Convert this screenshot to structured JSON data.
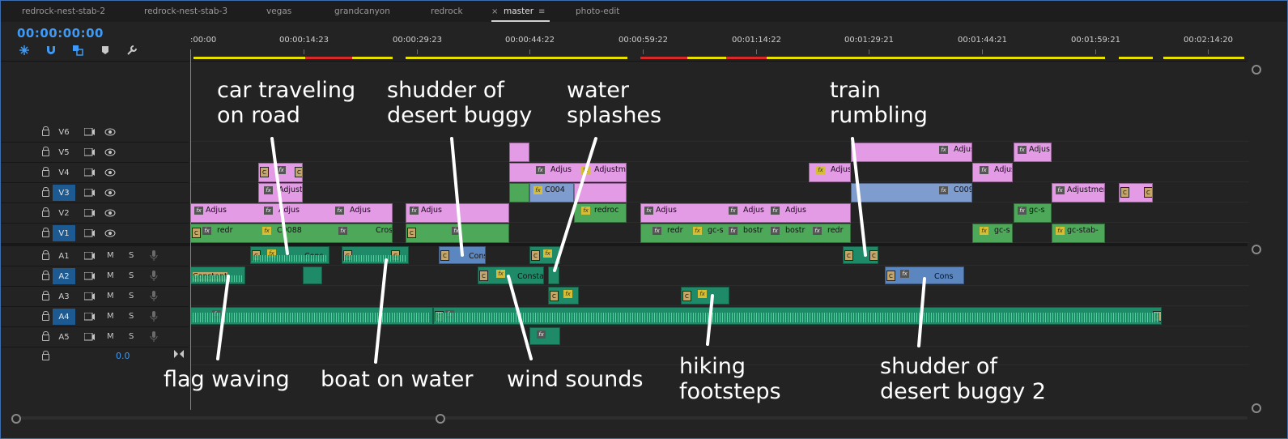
{
  "tabs": [
    {
      "label": "redrock-nest-stab-2"
    },
    {
      "label": "redrock-nest-stab-3"
    },
    {
      "label": "vegas"
    },
    {
      "label": "grandcanyon"
    },
    {
      "label": "redrock"
    },
    {
      "label": "master",
      "active": true
    },
    {
      "label": "photo-edit"
    }
  ],
  "tab_close_glyph": "×",
  "tab_menu_glyph": "≡",
  "timecode": "00:00:00:00",
  "toolbar": [
    {
      "icon": "snap-icon"
    },
    {
      "icon": "magnet-icon"
    },
    {
      "icon": "linked-selection-icon"
    },
    {
      "icon": "marker-icon"
    },
    {
      "icon": "wrench-icon"
    }
  ],
  "ruler_labels": [
    ":00:00",
    "00:00:14:23",
    "00:00:29:23",
    "00:00:44:22",
    "00:00:59:22",
    "00:01:14:22",
    "00:01:29:21",
    "00:01:44:21",
    "00:01:59:21",
    "00:02:14:20"
  ],
  "colors": {
    "accent": "#3f9af5",
    "render_yellow": "#e8e000",
    "render_red": "#d62a2a",
    "video_pink": "#e39be5",
    "video_blue": "#7f9ccf",
    "video_green": "#4da85a",
    "audio_green": "#1f8a68"
  },
  "video_tracks": [
    "V6",
    "V5",
    "V4",
    "V3",
    "V2",
    "V1"
  ],
  "audio_tracks": [
    "A1",
    "A2",
    "A3",
    "A4",
    "A5"
  ],
  "master_volume": "0.0",
  "track_buttons": {
    "mute": "M",
    "solo": "S"
  },
  "clip_labels": {
    "adjust": "Adjus",
    "adjustm": "Adjustme",
    "adjust2": "Adjust",
    "adjustment": "Adjustment",
    "c00": "C00",
    "c004": "C004",
    "c009": "C009",
    "c0088": "C0088",
    "redr": "redr",
    "redro": "redro",
    "redroc": "redroc",
    "gcs": "gc-s",
    "gcstab": "gc-stab-",
    "bost": "bostr",
    "crost": "Cros",
    "constant": "Constant",
    "cons": "Cons",
    "const": "Constan",
    "c": "C"
  },
  "annotations": [
    "car traveling\non road",
    "shudder of\ndesert buggy",
    "water\nsplashes",
    "train\nrumbling",
    "flag waving",
    "boat on water",
    "wind sounds",
    "hiking\nfootsteps",
    "shudder of\ndesert buggy 2"
  ]
}
